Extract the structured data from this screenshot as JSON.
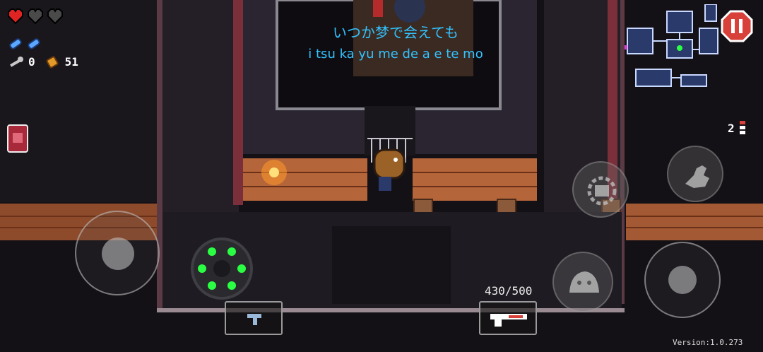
{
  "hud": {
    "hearts": [
      {
        "state": "full",
        "color": "#e02424"
      },
      {
        "state": "empty",
        "color": "#4a4a4a"
      },
      {
        "state": "empty",
        "color": "#4a4a4a"
      }
    ],
    "blanks_count": 2,
    "keys_count": "0",
    "shells_count": "51",
    "pause_icon": "pause-icon",
    "side_keys_count": "2",
    "ammo": "430/500",
    "version": "Version:1.0.273"
  },
  "subtitle": {
    "japanese": "いつか梦で会えても",
    "romaji": "i tsu ka yu me de a e te mo",
    "color": "#33c3ff"
  },
  "controls": {
    "move_joystick": "move-joystick",
    "aim_joystick": "aim-joystick",
    "interact_icon": "hand-icon",
    "reload_icon": "reload-icon",
    "dodge_icon": "dodge-roll-icon",
    "item_slot_icon": "pistol-icon",
    "gun_slot_icon": "shotgun-icon"
  },
  "colors": {
    "brick": "#b5653a",
    "floor": "#1e1a1f",
    "wall": "#3a2a30",
    "accent_red": "#d8403a"
  }
}
